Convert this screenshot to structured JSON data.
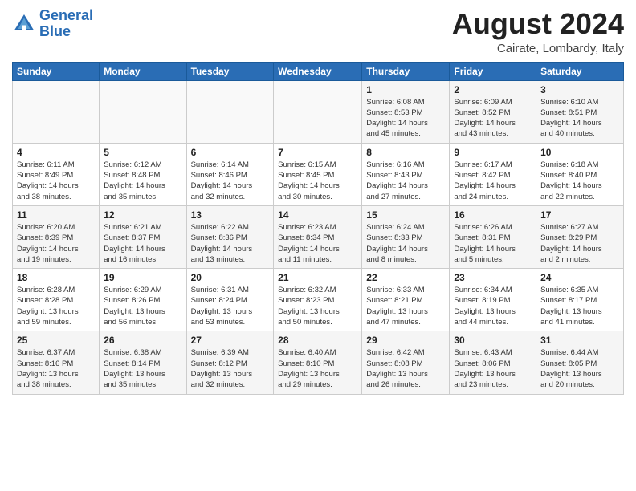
{
  "header": {
    "logo_line1": "General",
    "logo_line2": "Blue",
    "month_title": "August 2024",
    "location": "Cairate, Lombardy, Italy"
  },
  "weekdays": [
    "Sunday",
    "Monday",
    "Tuesday",
    "Wednesday",
    "Thursday",
    "Friday",
    "Saturday"
  ],
  "weeks": [
    [
      {
        "day": "",
        "info": ""
      },
      {
        "day": "",
        "info": ""
      },
      {
        "day": "",
        "info": ""
      },
      {
        "day": "",
        "info": ""
      },
      {
        "day": "1",
        "info": "Sunrise: 6:08 AM\nSunset: 8:53 PM\nDaylight: 14 hours\nand 45 minutes."
      },
      {
        "day": "2",
        "info": "Sunrise: 6:09 AM\nSunset: 8:52 PM\nDaylight: 14 hours\nand 43 minutes."
      },
      {
        "day": "3",
        "info": "Sunrise: 6:10 AM\nSunset: 8:51 PM\nDaylight: 14 hours\nand 40 minutes."
      }
    ],
    [
      {
        "day": "4",
        "info": "Sunrise: 6:11 AM\nSunset: 8:49 PM\nDaylight: 14 hours\nand 38 minutes."
      },
      {
        "day": "5",
        "info": "Sunrise: 6:12 AM\nSunset: 8:48 PM\nDaylight: 14 hours\nand 35 minutes."
      },
      {
        "day": "6",
        "info": "Sunrise: 6:14 AM\nSunset: 8:46 PM\nDaylight: 14 hours\nand 32 minutes."
      },
      {
        "day": "7",
        "info": "Sunrise: 6:15 AM\nSunset: 8:45 PM\nDaylight: 14 hours\nand 30 minutes."
      },
      {
        "day": "8",
        "info": "Sunrise: 6:16 AM\nSunset: 8:43 PM\nDaylight: 14 hours\nand 27 minutes."
      },
      {
        "day": "9",
        "info": "Sunrise: 6:17 AM\nSunset: 8:42 PM\nDaylight: 14 hours\nand 24 minutes."
      },
      {
        "day": "10",
        "info": "Sunrise: 6:18 AM\nSunset: 8:40 PM\nDaylight: 14 hours\nand 22 minutes."
      }
    ],
    [
      {
        "day": "11",
        "info": "Sunrise: 6:20 AM\nSunset: 8:39 PM\nDaylight: 14 hours\nand 19 minutes."
      },
      {
        "day": "12",
        "info": "Sunrise: 6:21 AM\nSunset: 8:37 PM\nDaylight: 14 hours\nand 16 minutes."
      },
      {
        "day": "13",
        "info": "Sunrise: 6:22 AM\nSunset: 8:36 PM\nDaylight: 14 hours\nand 13 minutes."
      },
      {
        "day": "14",
        "info": "Sunrise: 6:23 AM\nSunset: 8:34 PM\nDaylight: 14 hours\nand 11 minutes."
      },
      {
        "day": "15",
        "info": "Sunrise: 6:24 AM\nSunset: 8:33 PM\nDaylight: 14 hours\nand 8 minutes."
      },
      {
        "day": "16",
        "info": "Sunrise: 6:26 AM\nSunset: 8:31 PM\nDaylight: 14 hours\nand 5 minutes."
      },
      {
        "day": "17",
        "info": "Sunrise: 6:27 AM\nSunset: 8:29 PM\nDaylight: 14 hours\nand 2 minutes."
      }
    ],
    [
      {
        "day": "18",
        "info": "Sunrise: 6:28 AM\nSunset: 8:28 PM\nDaylight: 13 hours\nand 59 minutes."
      },
      {
        "day": "19",
        "info": "Sunrise: 6:29 AM\nSunset: 8:26 PM\nDaylight: 13 hours\nand 56 minutes."
      },
      {
        "day": "20",
        "info": "Sunrise: 6:31 AM\nSunset: 8:24 PM\nDaylight: 13 hours\nand 53 minutes."
      },
      {
        "day": "21",
        "info": "Sunrise: 6:32 AM\nSunset: 8:23 PM\nDaylight: 13 hours\nand 50 minutes."
      },
      {
        "day": "22",
        "info": "Sunrise: 6:33 AM\nSunset: 8:21 PM\nDaylight: 13 hours\nand 47 minutes."
      },
      {
        "day": "23",
        "info": "Sunrise: 6:34 AM\nSunset: 8:19 PM\nDaylight: 13 hours\nand 44 minutes."
      },
      {
        "day": "24",
        "info": "Sunrise: 6:35 AM\nSunset: 8:17 PM\nDaylight: 13 hours\nand 41 minutes."
      }
    ],
    [
      {
        "day": "25",
        "info": "Sunrise: 6:37 AM\nSunset: 8:16 PM\nDaylight: 13 hours\nand 38 minutes."
      },
      {
        "day": "26",
        "info": "Sunrise: 6:38 AM\nSunset: 8:14 PM\nDaylight: 13 hours\nand 35 minutes."
      },
      {
        "day": "27",
        "info": "Sunrise: 6:39 AM\nSunset: 8:12 PM\nDaylight: 13 hours\nand 32 minutes."
      },
      {
        "day": "28",
        "info": "Sunrise: 6:40 AM\nSunset: 8:10 PM\nDaylight: 13 hours\nand 29 minutes."
      },
      {
        "day": "29",
        "info": "Sunrise: 6:42 AM\nSunset: 8:08 PM\nDaylight: 13 hours\nand 26 minutes."
      },
      {
        "day": "30",
        "info": "Sunrise: 6:43 AM\nSunset: 8:06 PM\nDaylight: 13 hours\nand 23 minutes."
      },
      {
        "day": "31",
        "info": "Sunrise: 6:44 AM\nSunset: 8:05 PM\nDaylight: 13 hours\nand 20 minutes."
      }
    ]
  ]
}
